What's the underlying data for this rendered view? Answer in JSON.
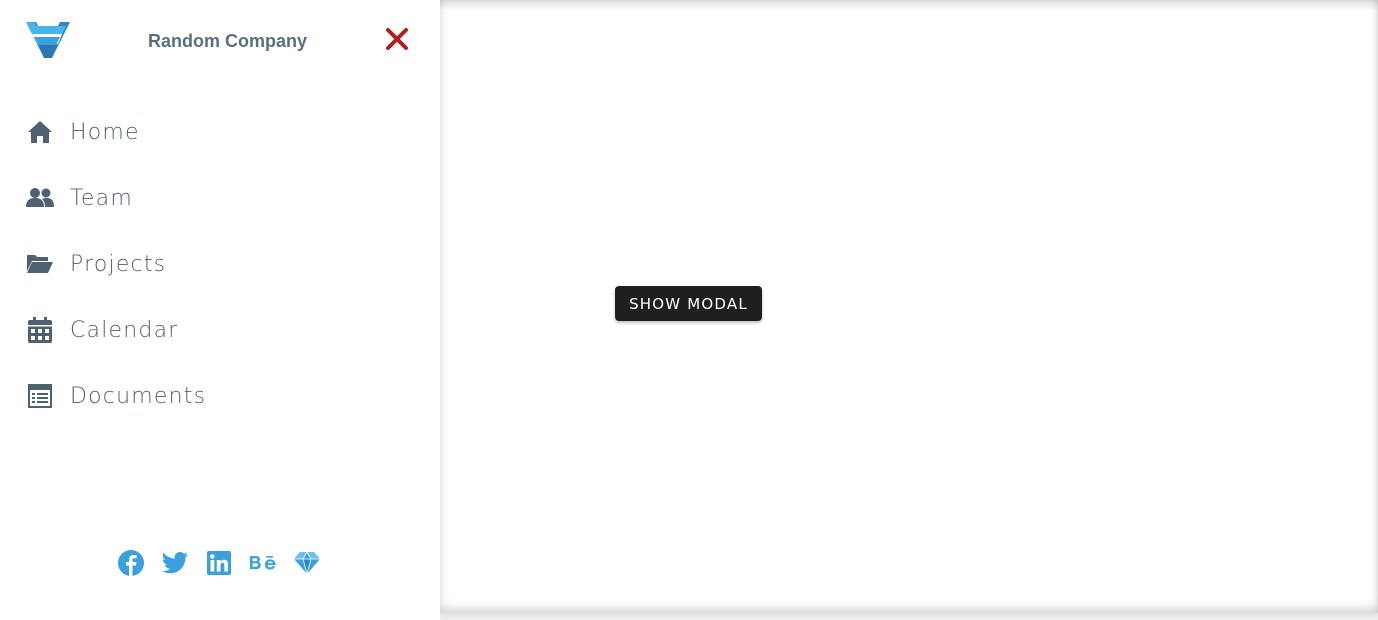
{
  "brand": {
    "company_name": "Random Company",
    "logo_icon": "checkmark-v-logo",
    "accent_color": "#3aa0e0"
  },
  "sidebar": {
    "close_icon": "close-icon",
    "close_color": "#b51c1c",
    "items": [
      {
        "label": "Home",
        "icon": "home-icon"
      },
      {
        "label": "Team",
        "icon": "users-icon"
      },
      {
        "label": "Projects",
        "icon": "folder-open-icon"
      },
      {
        "label": "Calendar",
        "icon": "calendar-icon"
      },
      {
        "label": "Documents",
        "icon": "documents-icon"
      }
    ],
    "social": [
      {
        "icon": "facebook-icon"
      },
      {
        "icon": "twitter-icon"
      },
      {
        "icon": "linkedin-icon"
      },
      {
        "icon": "behance-icon"
      },
      {
        "icon": "sketch-icon"
      }
    ]
  },
  "main": {
    "show_modal_label": "SHOW MODAL"
  }
}
